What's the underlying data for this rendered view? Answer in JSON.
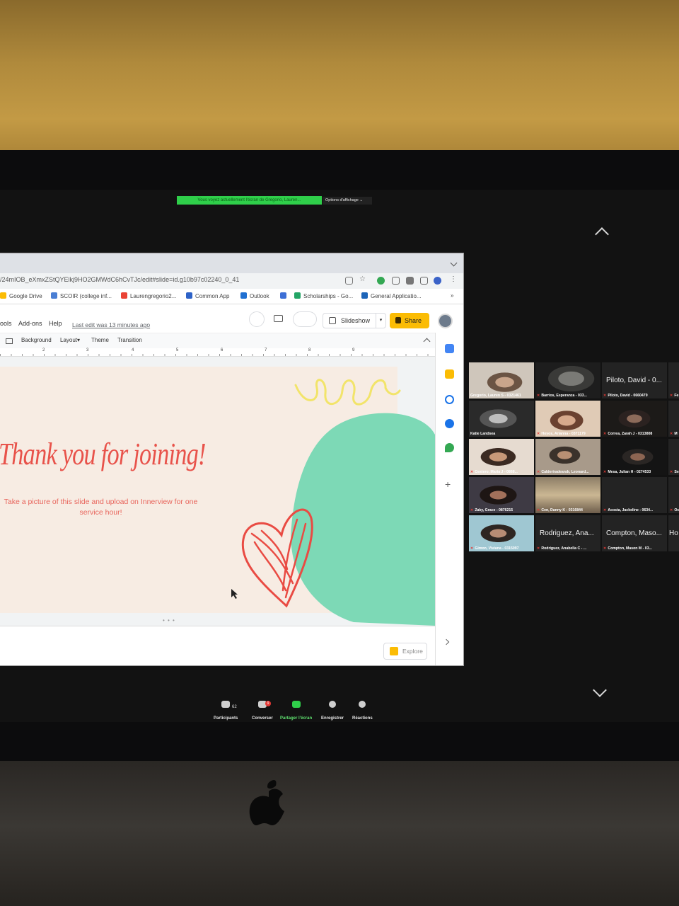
{
  "zoom": {
    "share_banner": "Vous voyez actuellement l'écran de Gregorio, Lauren...",
    "view_options": "Options d'affichage ⌄",
    "controls": [
      {
        "label": "Participants",
        "count": "62"
      },
      {
        "label": "Converser",
        "badge": "9"
      },
      {
        "label": "Partager l'écran"
      },
      {
        "label": "Enregistrer"
      },
      {
        "label": "Réactions"
      }
    ],
    "participants": [
      {
        "label": "Gregorio, Lauren S - 0321461"
      },
      {
        "label": "Barrios, Esperanza - 033..."
      },
      {
        "label": "Piloto, David - 0660479",
        "name": "Piloto, David - 0..."
      },
      {
        "label": "Katie Landsea"
      },
      {
        "label": "Hoyos, Arianna - 0371179"
      },
      {
        "label": "Correa, Zarah J - 0313808"
      },
      {
        "label": "Cestero, Maria J - 0868..."
      },
      {
        "label": "Calderiradeandr, Leonard..."
      },
      {
        "label": "Mesa, Julian H - 0274533"
      },
      {
        "label": "Zaky, Grace - 0876215"
      },
      {
        "label": "Cen, Danny K - 0316844"
      },
      {
        "label": "Acosta, Jackeline - 0634..."
      },
      {
        "label": "Gimon, Viviana - 0315097"
      },
      {
        "label": "Rodriguez, Anabella C - ...",
        "name": "Rodriguez, Ana..."
      },
      {
        "label": "Compton, Mason M - 03...",
        "name": "Compton, Maso..."
      },
      {
        "label": "Fe"
      },
      {
        "label": "M"
      },
      {
        "label": "Se"
      },
      {
        "label": "Oc"
      },
      {
        "label": "Ho",
        "name": "Ho"
      }
    ]
  },
  "browser": {
    "url": "/24mIOB_eXmxZStQYElkj9HO2GMWdC6hCvTJc/edit#slide=id.g10b97c02240_0_41",
    "bookmarks": [
      "Google Drive",
      "SCOIR (college inf...",
      "Laurengregorio2...",
      "Common App",
      "Outlook",
      "Scholarships - Go...",
      "General Applicatio..."
    ],
    "bookmarks_more": "»"
  },
  "slides": {
    "menus": [
      "ools",
      "Add-ons",
      "Help"
    ],
    "last_edit": "Last edit was 13 minutes ago",
    "slideshow_label": "Slideshow",
    "share_label": "Share",
    "toolbar": [
      "Background",
      "Layout▾",
      "Theme",
      "Transition"
    ],
    "ruler": [
      "2",
      "3",
      "4",
      "5",
      "6",
      "7",
      "8",
      "9"
    ],
    "slide_title": "Thank you for joining!",
    "slide_subtitle": "Take a picture of this slide and upload on Innerview for one service hour!",
    "explore_label": "Explore"
  },
  "colors": {
    "slide_bg": "#f7ece3",
    "title": "#e8524a",
    "blob": "#7dd9b6",
    "squiggle": "#f2e46a",
    "heart": "#e94b43",
    "share_button": "#fbbc04",
    "zoom_green": "#2fcf4a"
  }
}
